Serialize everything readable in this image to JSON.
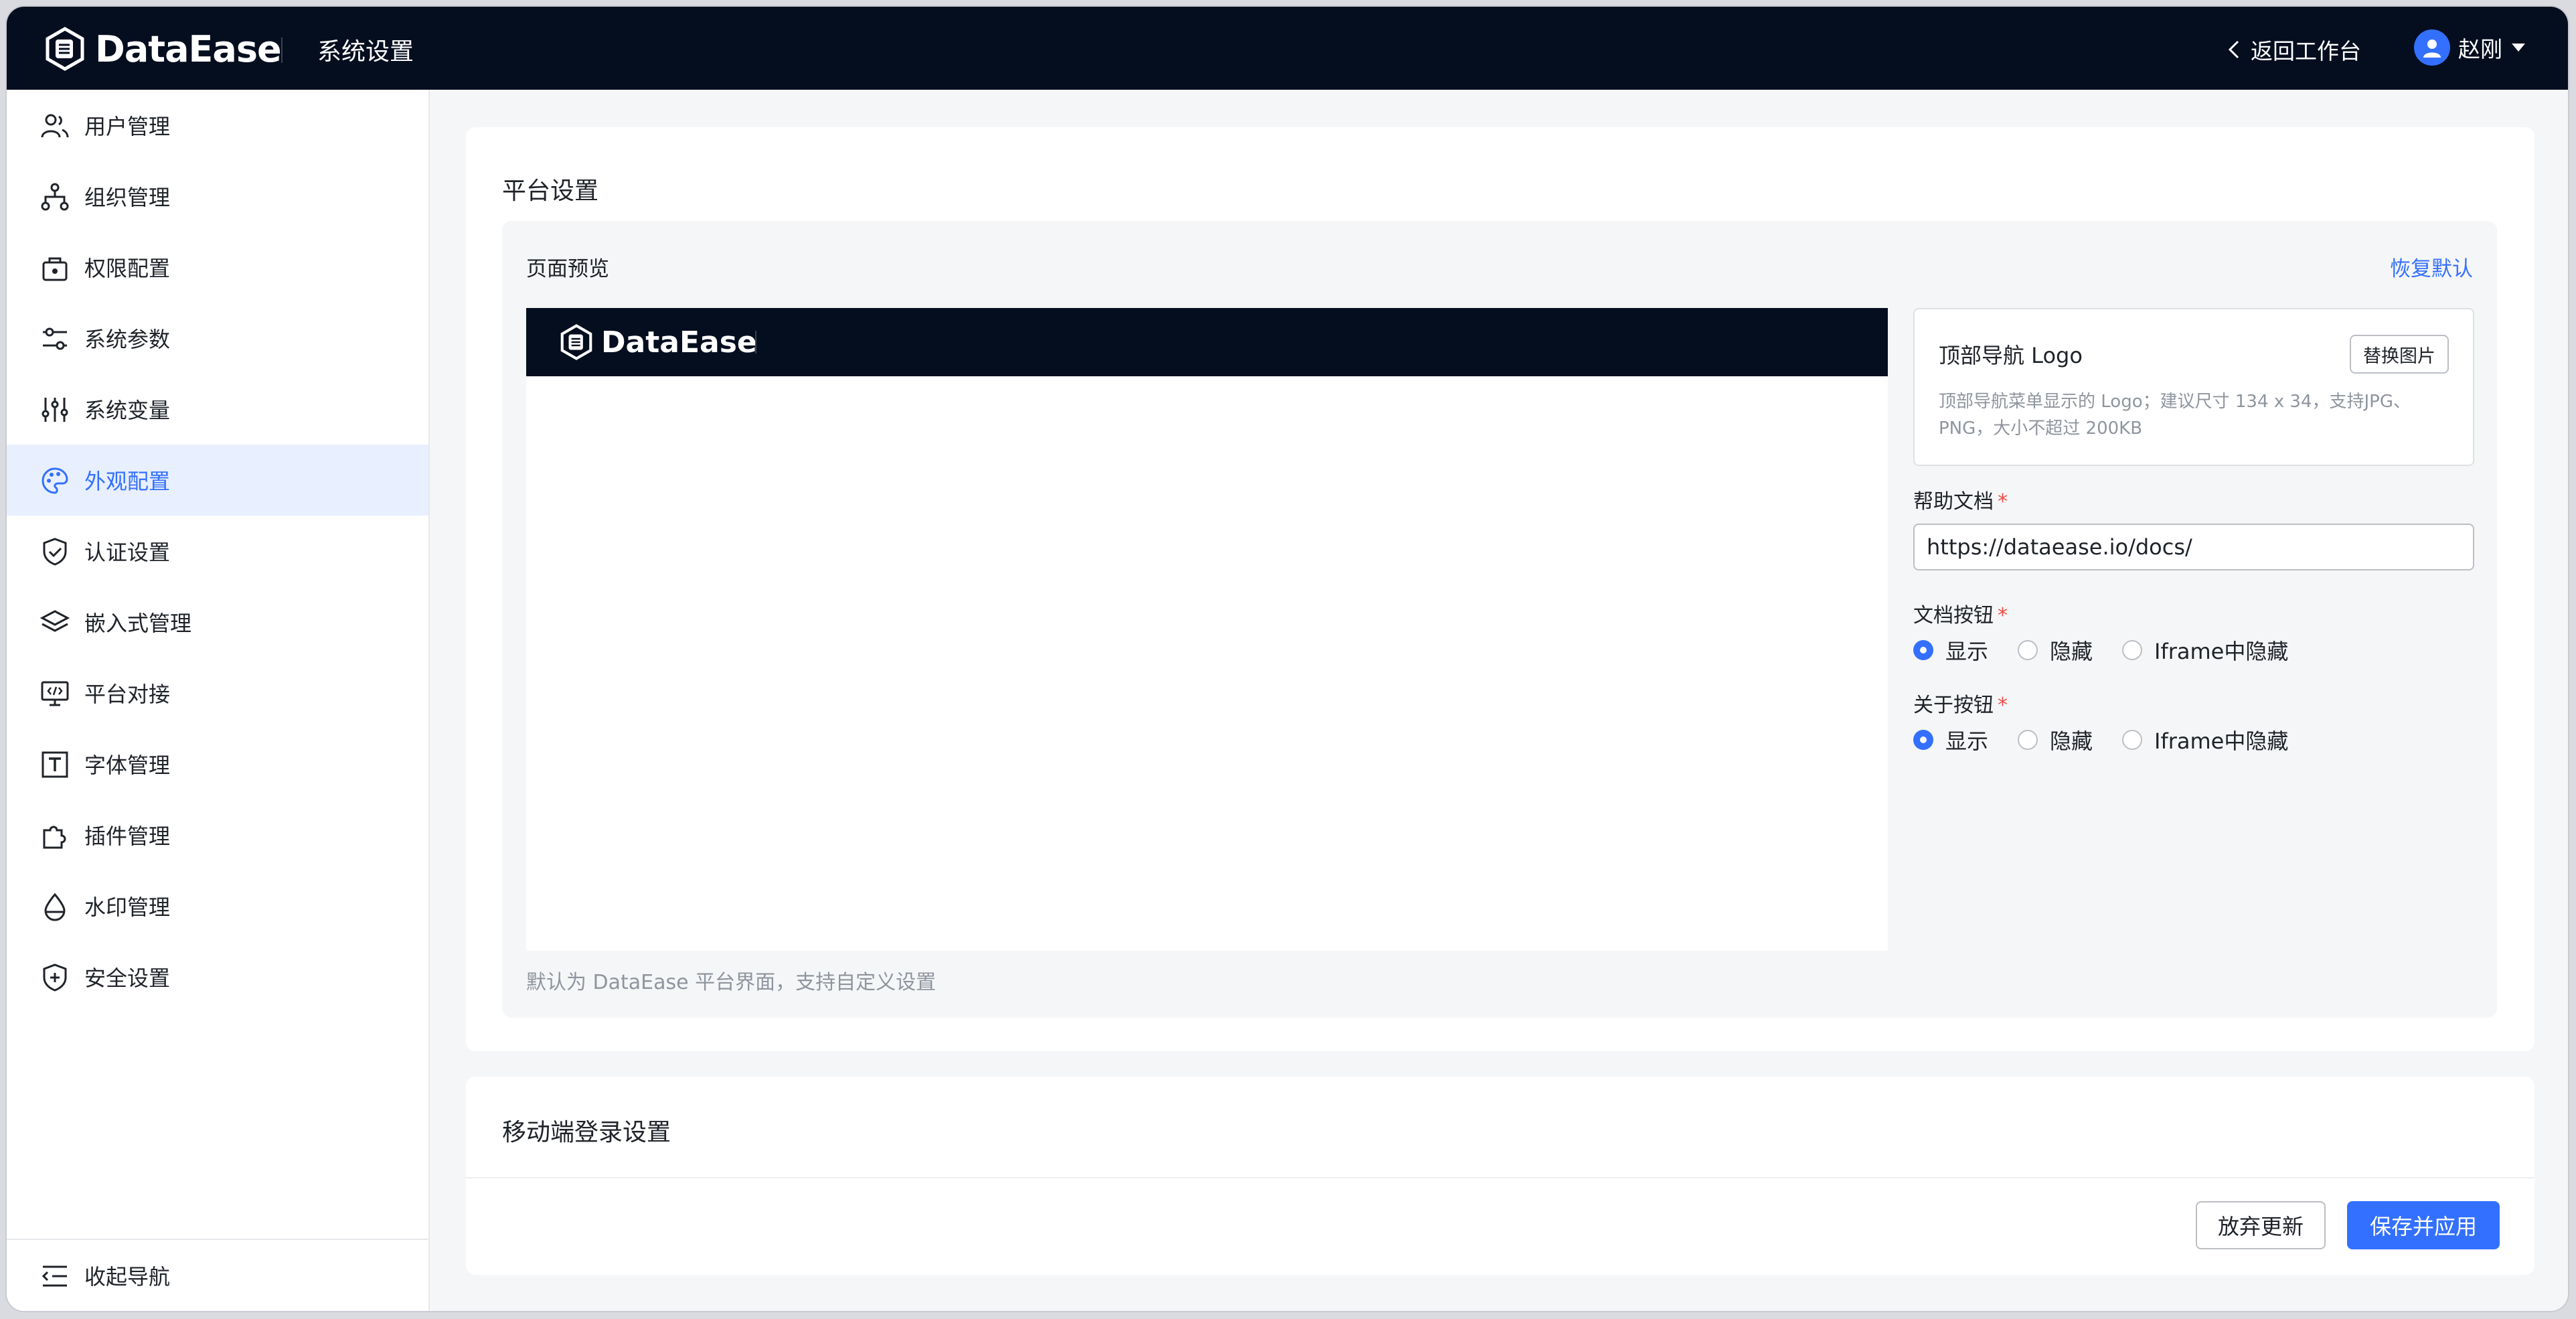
{
  "header": {
    "logo_text": "DataEase",
    "title": "系统设置",
    "back_label": "返回工作台",
    "user_name": "赵刚"
  },
  "sidebar": {
    "items": [
      {
        "label": "用户管理",
        "icon": "users-icon"
      },
      {
        "label": "组织管理",
        "icon": "org-tree-icon"
      },
      {
        "label": "权限配置",
        "icon": "lock-icon"
      },
      {
        "label": "系统参数",
        "icon": "sliders-icon"
      },
      {
        "label": "系统变量",
        "icon": "vertical-sliders-icon"
      },
      {
        "label": "外观配置",
        "icon": "palette-icon",
        "active": true
      },
      {
        "label": "认证设置",
        "icon": "shield-check-icon"
      },
      {
        "label": "嵌入式管理",
        "icon": "layers-icon"
      },
      {
        "label": "平台对接",
        "icon": "monitor-code-icon"
      },
      {
        "label": "字体管理",
        "icon": "font-icon"
      },
      {
        "label": "插件管理",
        "icon": "puzzle-icon"
      },
      {
        "label": "水印管理",
        "icon": "drop-icon"
      },
      {
        "label": "安全设置",
        "icon": "shield-plus-icon"
      }
    ],
    "collapse_label": "收起导航"
  },
  "platform": {
    "title": "平台设置",
    "preview_title": "页面预览",
    "restore_label": "恢复默认",
    "preview_logo_text": "DataEase",
    "preview_note": "默认为 DataEase 平台界面，支持自定义设置",
    "logo_setting": {
      "title": "顶部导航 Logo",
      "replace_label": "替换图片",
      "desc": "顶部导航菜单显示的 Logo；建议尺寸 134 x 34，支持JPG、PNG，大小不超过 200KB"
    },
    "help_doc": {
      "label": "帮助文档",
      "required": "*",
      "value": "https://dataease.io/docs/"
    },
    "doc_button": {
      "label": "文档按钮",
      "required": "*",
      "options": [
        "显示",
        "隐藏",
        "Iframe中隐藏"
      ],
      "selected": "显示"
    },
    "about_button": {
      "label": "关于按钮",
      "required": "*",
      "options": [
        "显示",
        "隐藏",
        "Iframe中隐藏"
      ],
      "selected": "显示"
    }
  },
  "mobile": {
    "title": "移动端登录设置"
  },
  "footer": {
    "cancel_label": "放弃更新",
    "save_label": "保存并应用"
  },
  "colors": {
    "accent": "#3370ff",
    "header_bg": "#050e1f",
    "active_bg": "#e8efff"
  }
}
